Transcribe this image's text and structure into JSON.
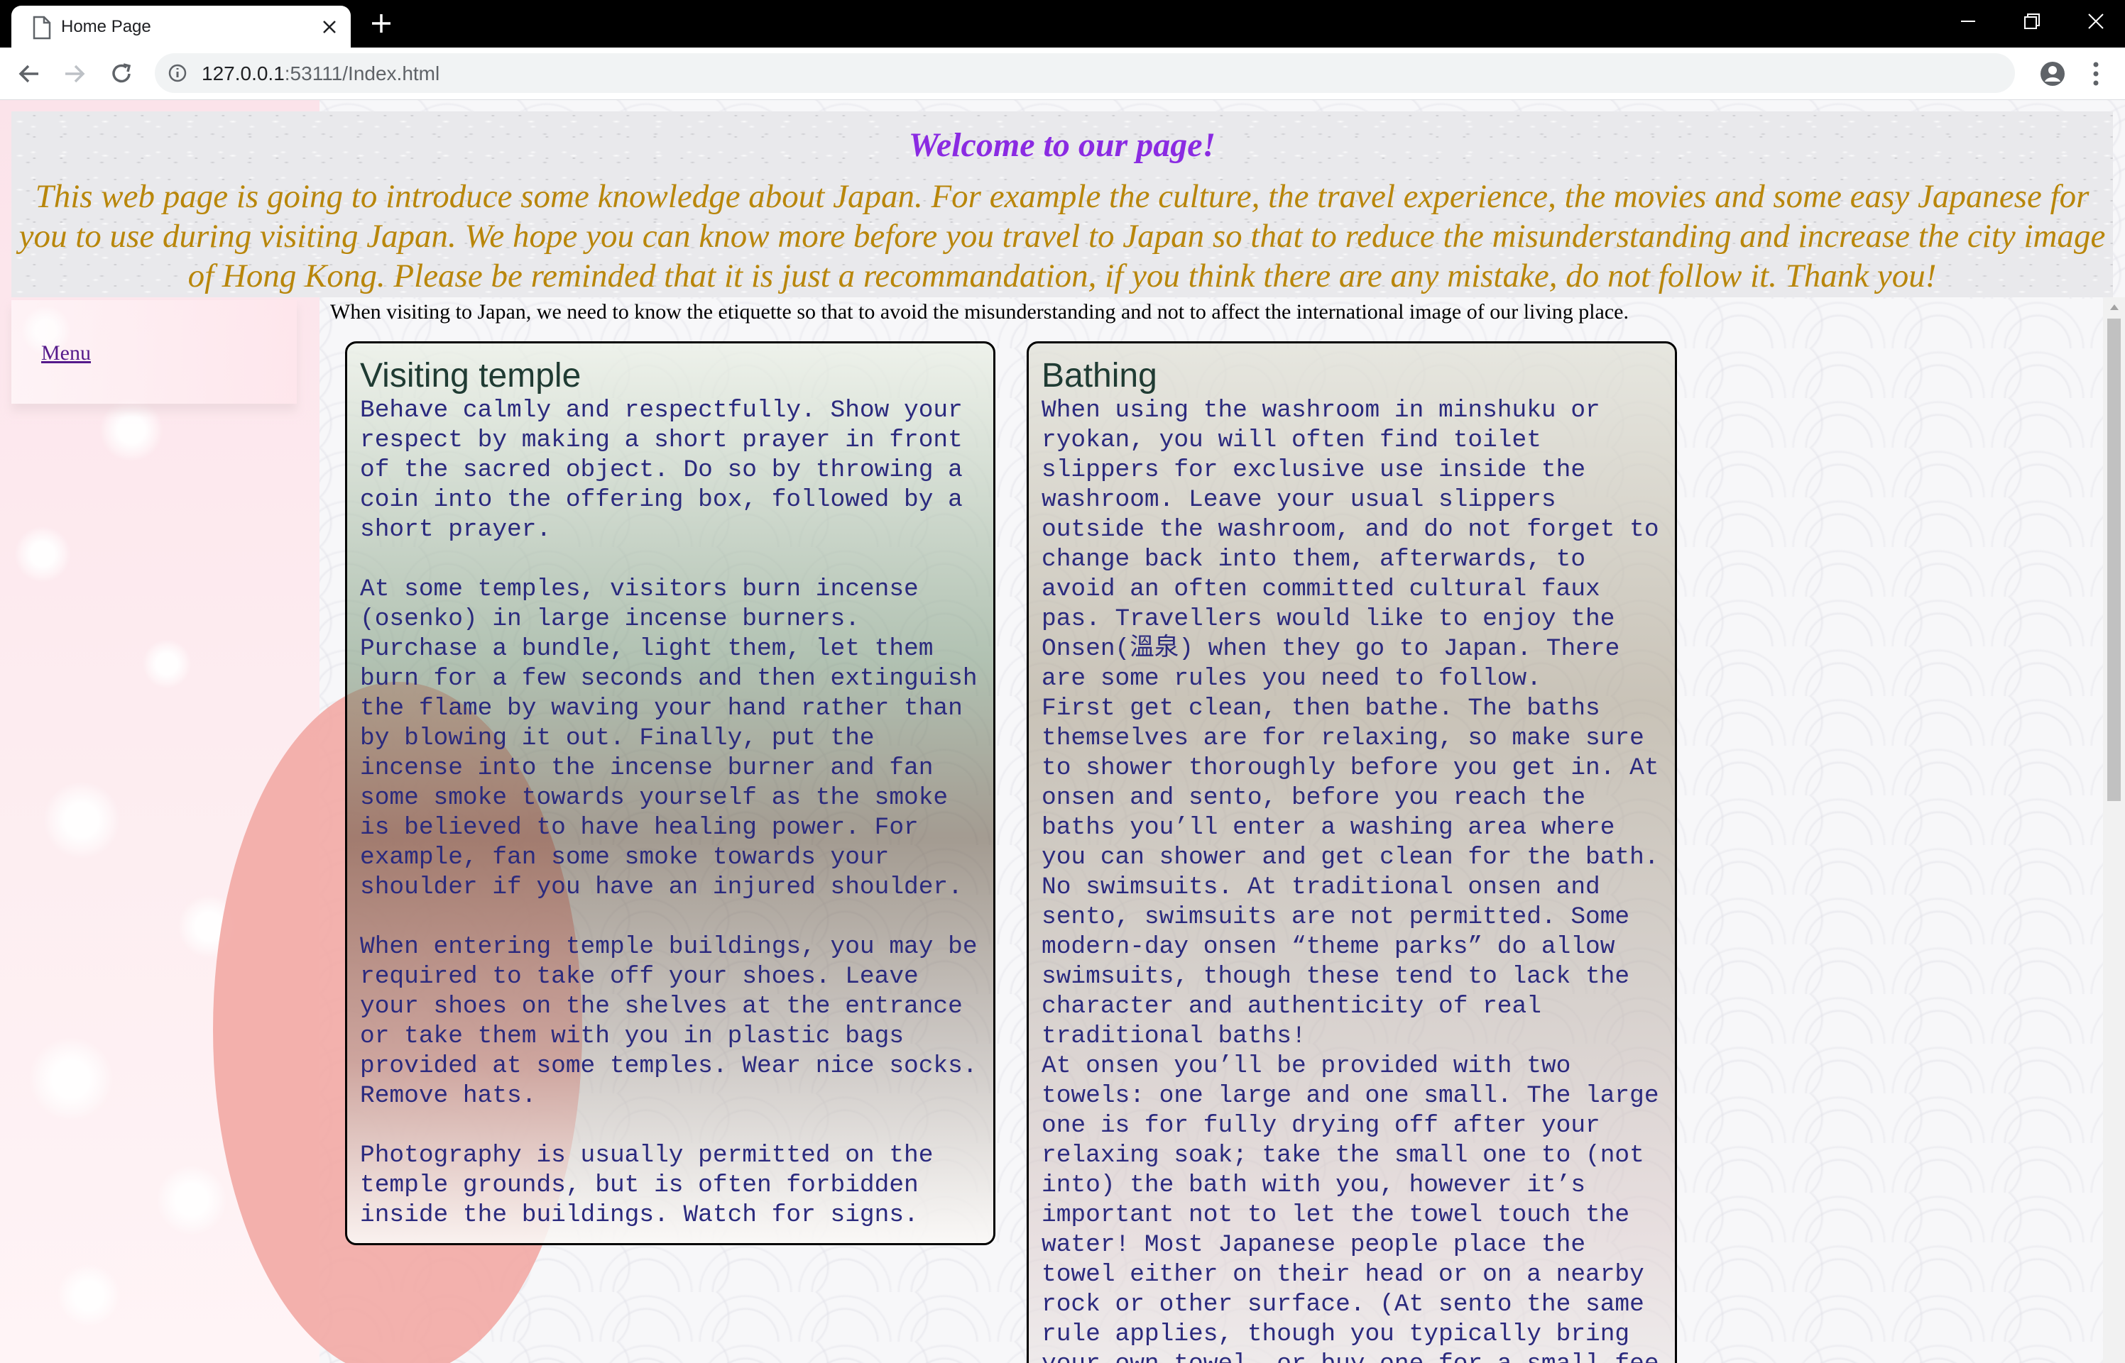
{
  "browser": {
    "tab_title": "Home Page",
    "url_host": "127.0.0.1",
    "url_rest": ":53111/Index.html"
  },
  "header": {
    "welcome": "Welcome to our page!",
    "intro": "This web page is going to introduce some knowledge about Japan. For example the culture, the travel experience, the movies and some easy Japanese for you to use during visiting Japan. We hope you can know more before you travel to Japan so that to reduce the misunderstanding and increase the city image of Hong Kong. Please be reminded that it is just a recommandation, if you think there are any mistake, do not follow it. Thank you!"
  },
  "sidebar": {
    "menu_label": "Menu"
  },
  "main": {
    "lead": "When visiting to Japan, we need to know the etiquette so that to avoid the misunderstanding and not to affect the international image of our living place.",
    "cards": [
      {
        "title": "Visiting temple",
        "body": "Behave calmly and respectfully. Show your respect by making a short prayer in front of the sacred object. Do so by throwing a coin into the offering box, followed by a short prayer.\n\nAt some temples, visitors burn incense (osenko) in large incense burners. Purchase a bundle, light them, let them burn for a few seconds and then extinguish the flame by waving your hand rather than by blowing it out. Finally, put the incense into the incense burner and fan some smoke towards yourself as the smoke is believed to have healing power. For example, fan some smoke towards your shoulder if you have an injured shoulder.\n\nWhen entering temple buildings, you may be required to take off your shoes. Leave your shoes on the shelves at the entrance or take them with you in plastic bags provided at some temples. Wear nice socks. Remove hats.\n\nPhotography is usually permitted on the temple grounds, but is often forbidden inside the buildings. Watch for signs."
      },
      {
        "title": "Bathing",
        "body": "When using the washroom in minshuku or ryokan, you will often find toilet slippers for exclusive use inside the washroom. Leave your usual slippers outside the washroom, and do not forget to change back into them, afterwards, to avoid an often committed cultural faux pas. Travellers would like to enjoy the Onsen(溫泉) when they go to Japan. There are some rules you need to follow.\nFirst get clean, then bathe. The baths themselves are for relaxing, so make sure to shower thoroughly before you get in. At onsen and sento, before you reach the baths you’ll enter a washing area where you can shower and get clean for the bath. No swimsuits. At traditional onsen and sento, swimsuits are not permitted. Some modern-day onsen “theme parks” do allow swimsuits, though these tend to lack the character and authenticity of real traditional baths!\nAt onsen you’ll be provided with two towels: one large and one small. The large one is for fully drying off after your relaxing soak; take the small one to (not into) the bath with you, however it’s important not to let the towel touch the water! Most Japanese people place the towel either on their head or on a nearby rock or other surface. (At sento the same rule applies, though you typically bring your own towel, or buy one for a small fee at the front desk)"
      }
    ]
  },
  "colors": {
    "welcome": "#8a2be2",
    "intro": "#b8860b",
    "card_text": "#2b2a7e",
    "link": "#551a8b"
  },
  "icons": [
    "document-icon",
    "close-icon",
    "plus-icon",
    "minimize-icon",
    "restore-icon",
    "window-close-icon",
    "back-icon",
    "forward-icon",
    "reload-icon",
    "info-icon",
    "star-icon",
    "account-icon",
    "menu-kebab-icon"
  ]
}
